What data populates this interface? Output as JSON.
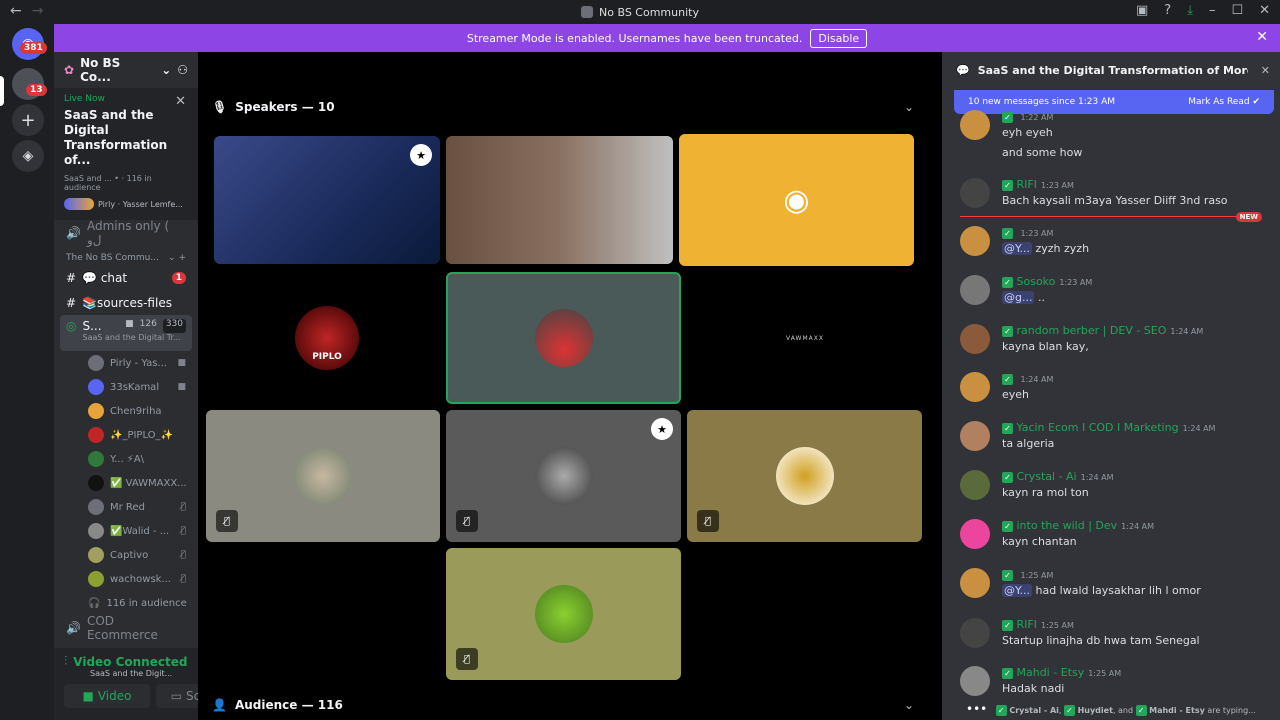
{
  "window": {
    "title": "No BS Community"
  },
  "banner": {
    "text": "Streamer Mode is enabled. Usernames have been truncated.",
    "button": "Disable"
  },
  "rail": {
    "badge1": "381",
    "badge2": "13"
  },
  "server": {
    "name": "No BS Co..."
  },
  "live": {
    "tag": "Live Now",
    "title": "SaaS and the Digital Transformation of...",
    "sub": "SaaS and ... • · 116 in audience",
    "hosts": "Pirly · Yasser Lemfe..."
  },
  "channels": {
    "admins": "Admins only ( ﻝﻭ",
    "category": "The No BS Commu...",
    "chat": "💬 chat",
    "chat_badge": "1",
    "sources": "📚sources-files",
    "stage": "S...",
    "stage_sub": "SaaS and the Digital Tr...",
    "stage_video": "126",
    "stage_count": "330",
    "cod": "COD Ecommerce"
  },
  "members": [
    {
      "name": "Pirly - Yas...",
      "color": "#6d6f78"
    },
    {
      "name": "33sKamal",
      "color": "#5865f2"
    },
    {
      "name": "Chen9riha",
      "color": "#e8a33b"
    },
    {
      "name": "✨_PIPLO_✨",
      "color": "#c02626"
    },
    {
      "name": "Y... ⚡A\\",
      "color": "#2f7a3b"
    },
    {
      "name": "✅ VAWMAXX...",
      "color": "#111"
    },
    {
      "name": "Mr Red",
      "color": "#6d6f78"
    },
    {
      "name": "✅Walid - ...",
      "color": "#888"
    },
    {
      "name": "Captivo",
      "color": "#a0a060"
    },
    {
      "name": "wachowsk...",
      "color": "#8aa030"
    }
  ],
  "audience_count": "116 in audience",
  "voice": {
    "state": "Video Connected",
    "sub": "SaaS and the Digit...",
    "video": "Video",
    "screen": "Screen"
  },
  "stage": {
    "speakers": "Speakers — 10",
    "audience": "Audience — 116",
    "piplo": "PIPLO",
    "vawmaxx": "VAWMAXX"
  },
  "chat_panel": {
    "title": "SaaS and the Digital Transformation of Moroccan In",
    "newbar": "10 new messages since 1:23 AM",
    "mark": "Mark As Read",
    "new_tag": "NEW"
  },
  "messages": [
    {
      "name": "",
      "time": "1:22 AM",
      "text": "eyh eyeh",
      "text2": "and some how"
    },
    {
      "name": "RIFI",
      "time": "1:23 AM",
      "text": "Bach kaysali m3aya Yasser Diiff 3nd raso"
    },
    {
      "name": "",
      "time": "1:23 AM",
      "mention": "@Y...",
      "text": "zyzh zyzh"
    },
    {
      "name": "Sosoko",
      "time": "1:23 AM",
      "mention": "@g...",
      "text": ".."
    },
    {
      "name": "random berber | DEV - SEO",
      "time": "1:24 AM",
      "text": "kayna blan kay,"
    },
    {
      "name": "",
      "time": "1:24 AM",
      "text": "eyeh"
    },
    {
      "name": "Yacin Ecom I COD I Marketing",
      "time": "1:24 AM",
      "text": "ta algeria"
    },
    {
      "name": "Crystal - Ai",
      "time": "1:24 AM",
      "text": "kayn ra mol ton"
    },
    {
      "name": "into the wild | Dev",
      "time": "1:24 AM",
      "text": "kayn chantan"
    },
    {
      "name": "",
      "time": "1:25 AM",
      "mention": "@Y...",
      "text": "had lwald laysakhar lih l omor"
    },
    {
      "name": "RIFI",
      "time": "1:25 AM",
      "text": "Startup linajha db hwa tam Senegal"
    },
    {
      "name": "Mahdi - Etsy",
      "time": "1:25 AM",
      "text": "Hadak nadi"
    }
  ],
  "typing": {
    "a": "Crystal - Ai",
    "b": "Huydiet",
    "c": "Mahdi - Etsy",
    "sep1": ",",
    "sep2": ", and",
    "tail": "are typing..."
  }
}
